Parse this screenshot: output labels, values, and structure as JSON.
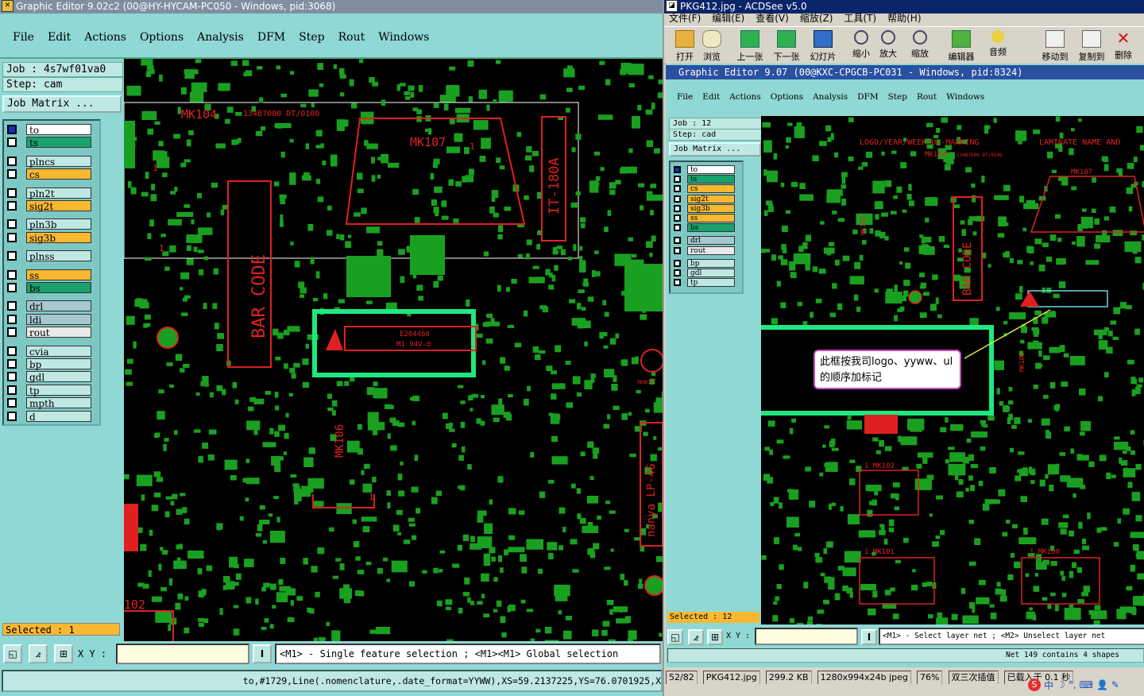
{
  "left": {
    "title": "Graphic Editor 9.02c2 (00@HY-HYCAM-PC050 - Windows, pid:3068)",
    "menu": [
      "File",
      "Edit",
      "Actions",
      "Options",
      "Analysis",
      "DFM",
      "Step",
      "Rout",
      "Windows"
    ],
    "job": "Job : 4s7wf01va0",
    "step": "Step: cam",
    "job_matrix": "Job Matrix ...",
    "layers": [
      {
        "name": "to",
        "color": "#ffffff"
      },
      {
        "name": "ts",
        "color": "#1aa26e"
      },
      {
        "name": "plncs",
        "color": "#bfe8e4"
      },
      {
        "name": "cs",
        "color": "#f8b830"
      },
      {
        "name": "pln2t",
        "color": "#bfe8e4"
      },
      {
        "name": "sig2t",
        "color": "#f8b830"
      },
      {
        "name": "pln3b",
        "color": "#bfe8e4"
      },
      {
        "name": "sig3b",
        "color": "#f8b830"
      },
      {
        "name": "plnss",
        "color": "#bfe8e4"
      },
      {
        "name": "ss",
        "color": "#f8b830"
      },
      {
        "name": "bs",
        "color": "#1aa26e"
      },
      {
        "name": "drl",
        "color": "#a8c8d0"
      },
      {
        "name": "ldi",
        "color": "#a8c8d0"
      },
      {
        "name": "rout",
        "color": "#e8e8e8"
      },
      {
        "name": "cvia",
        "color": "#bfe8e4"
      },
      {
        "name": "bp",
        "color": "#bfe8e4"
      },
      {
        "name": "gdl",
        "color": "#bfe8e4"
      },
      {
        "name": "tp",
        "color": "#bfe8e4"
      },
      {
        "name": "mpth",
        "color": "#bfe8e4"
      },
      {
        "name": "d",
        "color": "#bfe8e4"
      }
    ],
    "selected": "Selected : 1",
    "xy_label": "X Y :",
    "hint": "<M1> - Single feature selection ; <M1><M1> Global selection",
    "bottom_status": "to,#1729,Line(.nomenclature,.date_format=YYWW),XS=59.2137225,YS=76.0701925,X",
    "board_labels": {
      "mk104": "MK104",
      "mk104_sub": "134B7000 DT/0100",
      "mk107": "MK107",
      "mk107_pin": "1",
      "barcode": "BAR CODE",
      "it180a": "IT-180A",
      "mk106": "MK106",
      "ul_code": "E204460",
      "ul_code2": "M1 94V-0",
      "nanya": "nanya LP-4G",
      "lead": "lead-f",
      "n102": "102",
      "one_a": "1",
      "one_b": "1",
      "one_c": "1"
    }
  },
  "right": {
    "title": "PKG412.jpg - ACDSee v5.0",
    "menu": [
      "文件(F)",
      "编辑(E)",
      "查看(V)",
      "缩放(Z)",
      "工具(T)",
      "帮助(H)"
    ],
    "tools": [
      "打开",
      "浏览",
      "上一张",
      "下一张",
      "幻灯片",
      "缩小",
      "放大",
      "缩放",
      "编辑器",
      "音频",
      "移动到",
      "复制到",
      "删除"
    ],
    "inner_title": "Graphic Editor 9.07 (00@KXC-CPGCB-PC031 - Windows, pid:8324)",
    "inner_menu": [
      "File",
      "Edit",
      "Actions",
      "Options",
      "Analysis",
      "DFM",
      "Step",
      "Rout",
      "Windows"
    ],
    "job": "Job : 12",
    "step": "Step: cad",
    "job_matrix": "Job Matrix ...",
    "layers": [
      {
        "name": "to",
        "color": "#ffffff"
      },
      {
        "name": "ts",
        "color": "#1aa26e"
      },
      {
        "name": "cs",
        "color": "#f8b830"
      },
      {
        "name": "sig2t",
        "color": "#f8b830"
      },
      {
        "name": "sig3b",
        "color": "#f8b830"
      },
      {
        "name": "ss",
        "color": "#f8b830"
      },
      {
        "name": "bs",
        "color": "#1aa26e"
      },
      {
        "name": "drl",
        "color": "#a8c8d0"
      },
      {
        "name": "rout",
        "color": "#e8e8e8"
      },
      {
        "name": "bp",
        "color": "#bfe8e4"
      },
      {
        "name": "gdl",
        "color": "#bfe8e4"
      },
      {
        "name": "tp",
        "color": "#bfe8e4"
      }
    ],
    "selected": "Selected : 12",
    "xy_label": "X Y :",
    "hint": "<M1> - Select layer net ; <M2> Unselect layer net",
    "net_info": "Net 149 contains 4 shapes",
    "board_labels": {
      "logo_title": "LOGO/YEAR/WEEK/UL-MARKING",
      "laminate": "LAMINATE NAME AND",
      "mk104": "MK104",
      "mk104_sub": "134B7000 DT/0100",
      "mk107": "MK107",
      "mk105": "MK105",
      "barcode": "BAR CODE",
      "mk106": "MK106",
      "mk102": "1 MK102",
      "mk101": "1 MK101",
      "mk100": "1 MK100"
    },
    "callout": "此框按我司logo、yyww、ul的顺序加标记",
    "statusbar": [
      "52/82",
      "PKG412.jpg",
      "299.2 KB",
      "1280x994x24b jpeg",
      "76%",
      "双三次插值",
      "已载入于 0.1 秒"
    ]
  }
}
